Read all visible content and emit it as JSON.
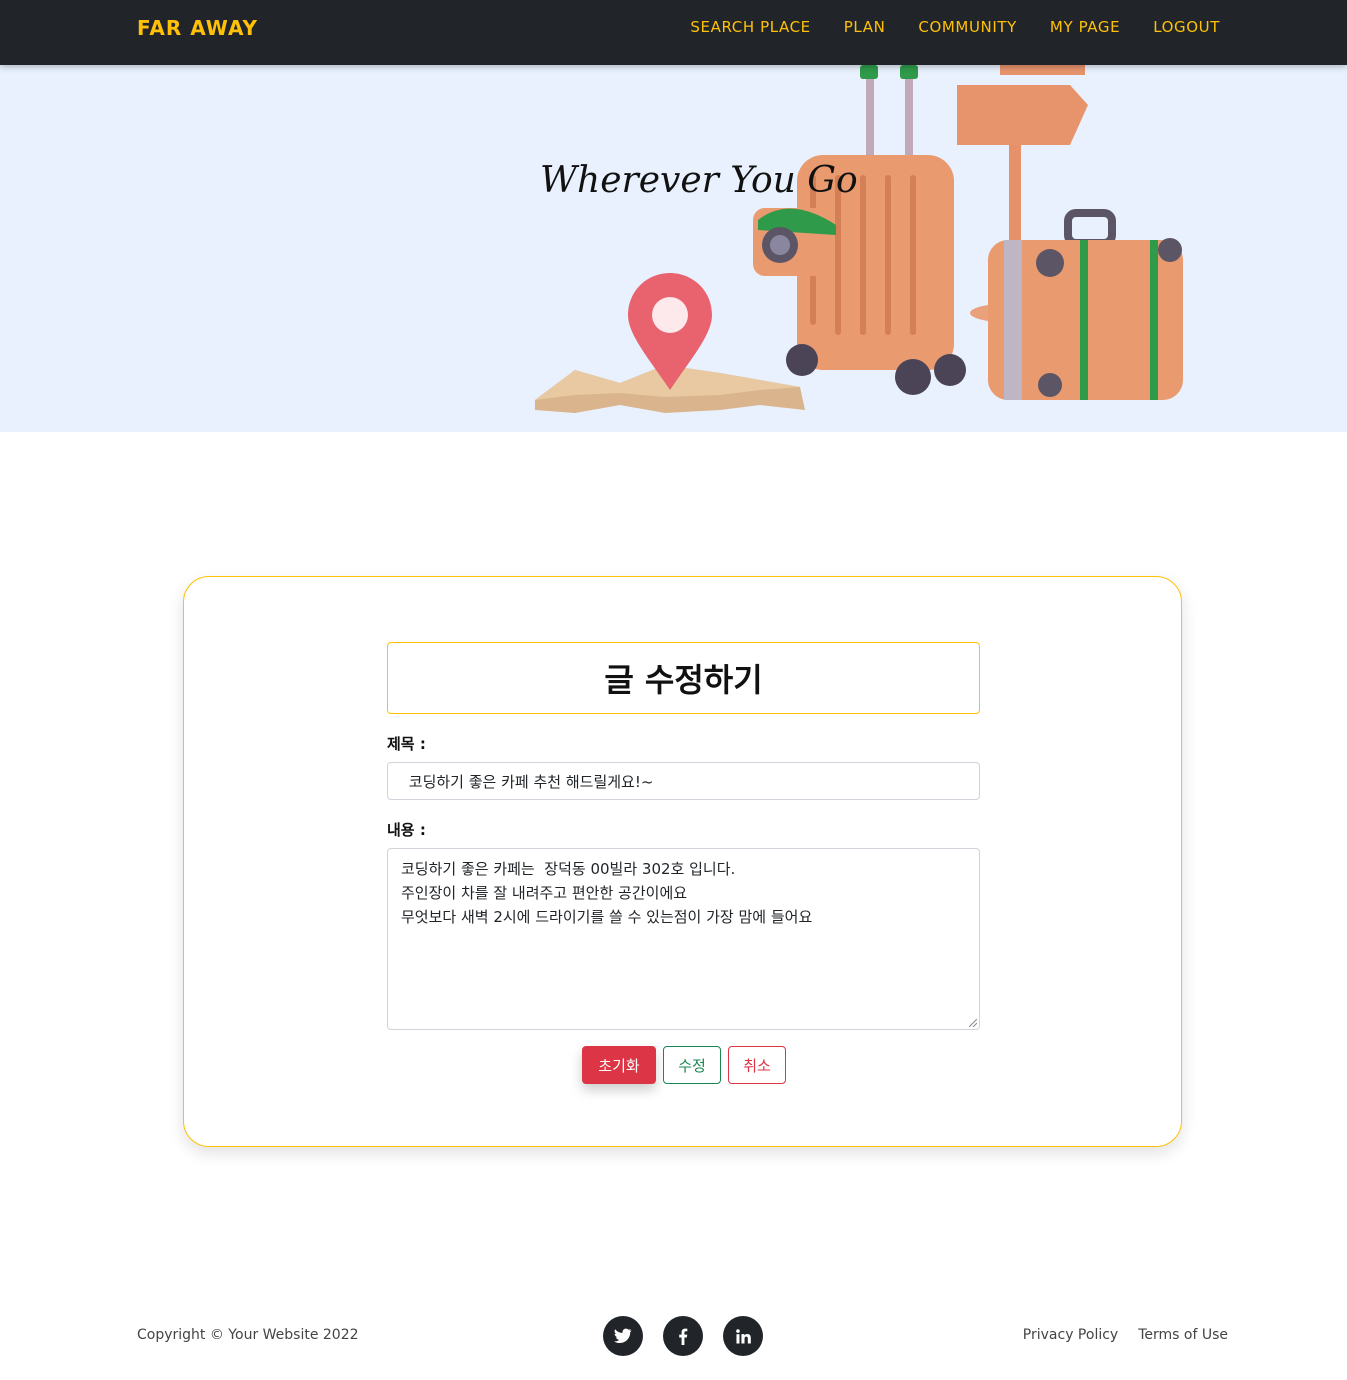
{
  "navbar": {
    "brand": "FAR AWAY",
    "links": [
      "SEARCH PLACE",
      "PLAN",
      "COMMUNITY",
      "MY PAGE",
      "LOGOUT"
    ]
  },
  "hero": {
    "title": "Wherever You Go"
  },
  "form": {
    "heading": "글 수정하기",
    "title_label": "제목 :",
    "title_value": " 코딩하기 좋은 카페 추천 해드릴게요!~",
    "content_label": "내용 :",
    "content_value": "코딩하기 좋은 카페는  장덕동 00빌라 302호 입니다.\n주인장이 차를 잘 내려주고 편안한 공간이에요\n무엇보다 새벽 2시에 드라이기를 쓸 수 있는점이 가장 맘에 들어요",
    "buttons": {
      "reset": "초기화",
      "edit": "수정",
      "cancel": "취소"
    }
  },
  "footer": {
    "copyright": "Copyright © Your Website 2022",
    "social_icons": [
      "twitter-icon",
      "facebook-icon",
      "linkedin-icon"
    ],
    "links": [
      "Privacy Policy",
      "Terms of Use"
    ]
  },
  "colors": {
    "accent": "#ffc107",
    "navbar_bg": "#212529",
    "hero_bg": "#e8f1fd",
    "danger": "#dc3545",
    "success": "#198754"
  }
}
